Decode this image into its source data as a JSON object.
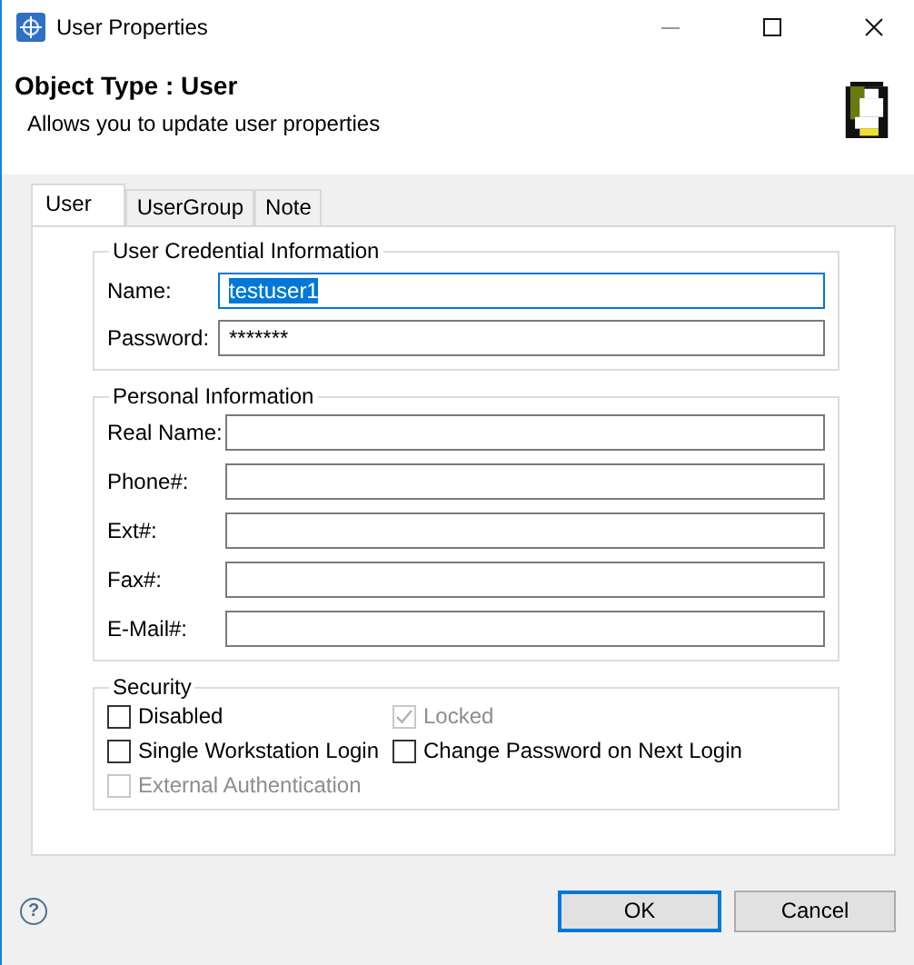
{
  "window": {
    "title": "User Properties"
  },
  "header": {
    "title": "Object Type : User",
    "subtitle": "Allows you to update user properties"
  },
  "tabs": [
    {
      "label": "User",
      "selected": true
    },
    {
      "label": "UserGroup",
      "selected": false
    },
    {
      "label": "Note",
      "selected": false
    }
  ],
  "groups": [
    {
      "title": "User Credential Information",
      "fields": [
        {
          "label": "Name:",
          "value": "testuser1",
          "focused": true
        },
        {
          "label": "Password:",
          "value": "*******",
          "focused": false
        }
      ]
    },
    {
      "title": "Personal Information",
      "fields": [
        {
          "label": "Real Name:",
          "focused": false
        },
        {
          "label": "Phone#:",
          "focused": false
        },
        {
          "label": "Ext#:",
          "focused": false
        },
        {
          "label": "Fax#:",
          "focused": false
        },
        {
          "label": "E-Mail#:",
          "focused": false
        }
      ]
    }
  ],
  "security": {
    "title": "Security",
    "options": [
      {
        "label": "Disabled",
        "checked": false,
        "disabled": false
      },
      {
        "label": "Locked",
        "checked": true,
        "disabled": true
      },
      {
        "label": "Single Workstation Login",
        "checked": false,
        "disabled": false
      },
      {
        "label": "Change Password on Next Login",
        "checked": false,
        "disabled": false
      },
      {
        "label": "External Authentication",
        "checked": false,
        "disabled": true
      }
    ]
  },
  "help": {
    "label": "?"
  },
  "buttons": [
    {
      "label": "OK",
      "default": true
    },
    {
      "label": "Cancel",
      "default": false
    }
  ]
}
